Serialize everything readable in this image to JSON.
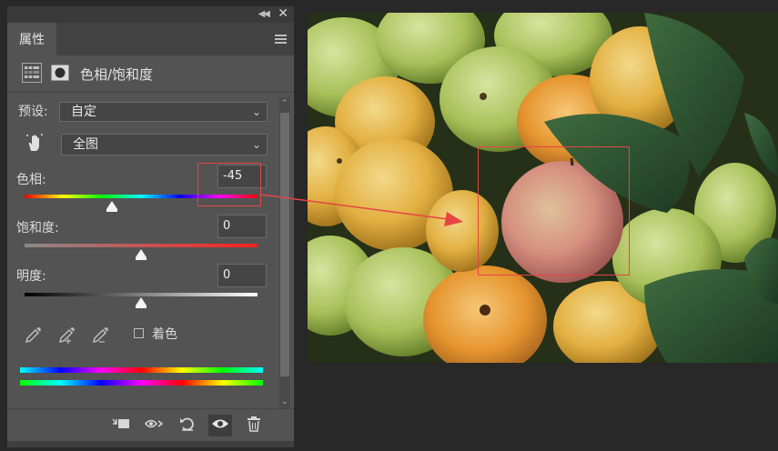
{
  "panel": {
    "tab_label": "属性",
    "title": "色相/饱和度",
    "preset_label": "预设:",
    "preset_value": "自定",
    "channel_value": "全图",
    "hue_label": "色相:",
    "hue_value": "-45",
    "saturation_label": "饱和度:",
    "saturation_value": "0",
    "lightness_label": "明度:",
    "lightness_value": "0",
    "colorize_label": "着色",
    "colorize_checked": false
  },
  "sliders": {
    "hue": {
      "min": -180,
      "max": 180,
      "value": -45
    },
    "saturation": {
      "min": -100,
      "max": 100,
      "value": 0
    },
    "lightness": {
      "min": -100,
      "max": 100,
      "value": 0
    }
  },
  "colors": {
    "panel_bg": "#535353",
    "annotation": "#e64545",
    "app_bg": "#282828"
  },
  "icons": [
    "collapse-icon",
    "close-icon",
    "panel-menu-icon",
    "adjustment-icon",
    "mask-icon",
    "hand-target-icon",
    "eyedropper-icon",
    "eyedropper-plus-icon",
    "eyedropper-minus-icon",
    "clip-to-layer-icon",
    "view-previous-icon",
    "reset-icon",
    "visibility-icon",
    "delete-icon"
  ]
}
